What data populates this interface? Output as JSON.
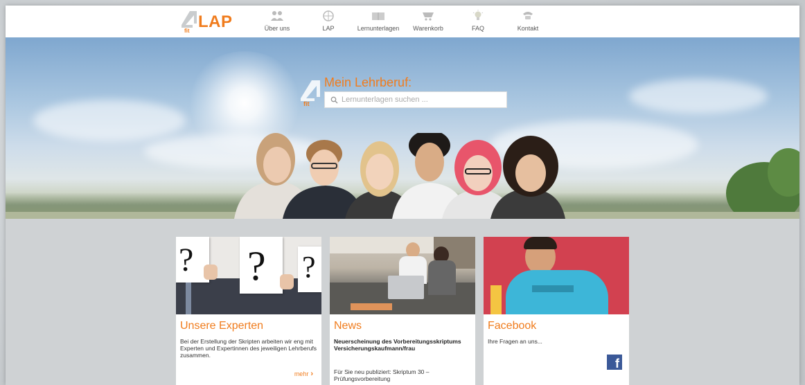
{
  "nav": {
    "logo_text": "LAP",
    "logo_mark_text": "fit",
    "items": [
      {
        "label": "Über uns",
        "icon": "people-icon"
      },
      {
        "label": "LAP",
        "icon": "globe-icon"
      },
      {
        "label": "Lernunterlagen",
        "icon": "book-icon"
      },
      {
        "label": "Warenkorb",
        "icon": "cart-icon"
      },
      {
        "label": "FAQ",
        "icon": "lightbulb-icon"
      },
      {
        "label": "Kontakt",
        "icon": "phone-icon"
      }
    ]
  },
  "hero": {
    "title": "Mein Lehrberuf:",
    "search_placeholder": "Lernunterlagen suchen ...",
    "logo_mark_text": "fit"
  },
  "cards": [
    {
      "title": "Unsere Experten",
      "text": "Bei der Erstellung der Skripten arbeiten wir eng mit Experten und Expertinnen des jeweiligen Lehrberufs zusammen.",
      "more": "mehr",
      "question_mark": "?"
    },
    {
      "title": "News",
      "headline": "Neuerscheinung des Vorbereitungsskriptums Versicherungskaufmann/frau",
      "text": "Für Sie neu publiziert: Skriptum 30 – Prüfungsvorbereitung"
    },
    {
      "title": "Facebook",
      "text": "Ihre Fragen an uns...",
      "fb_letter": "f"
    }
  ],
  "colors": {
    "accent": "#f07c1d",
    "facebook": "#3b5998"
  }
}
